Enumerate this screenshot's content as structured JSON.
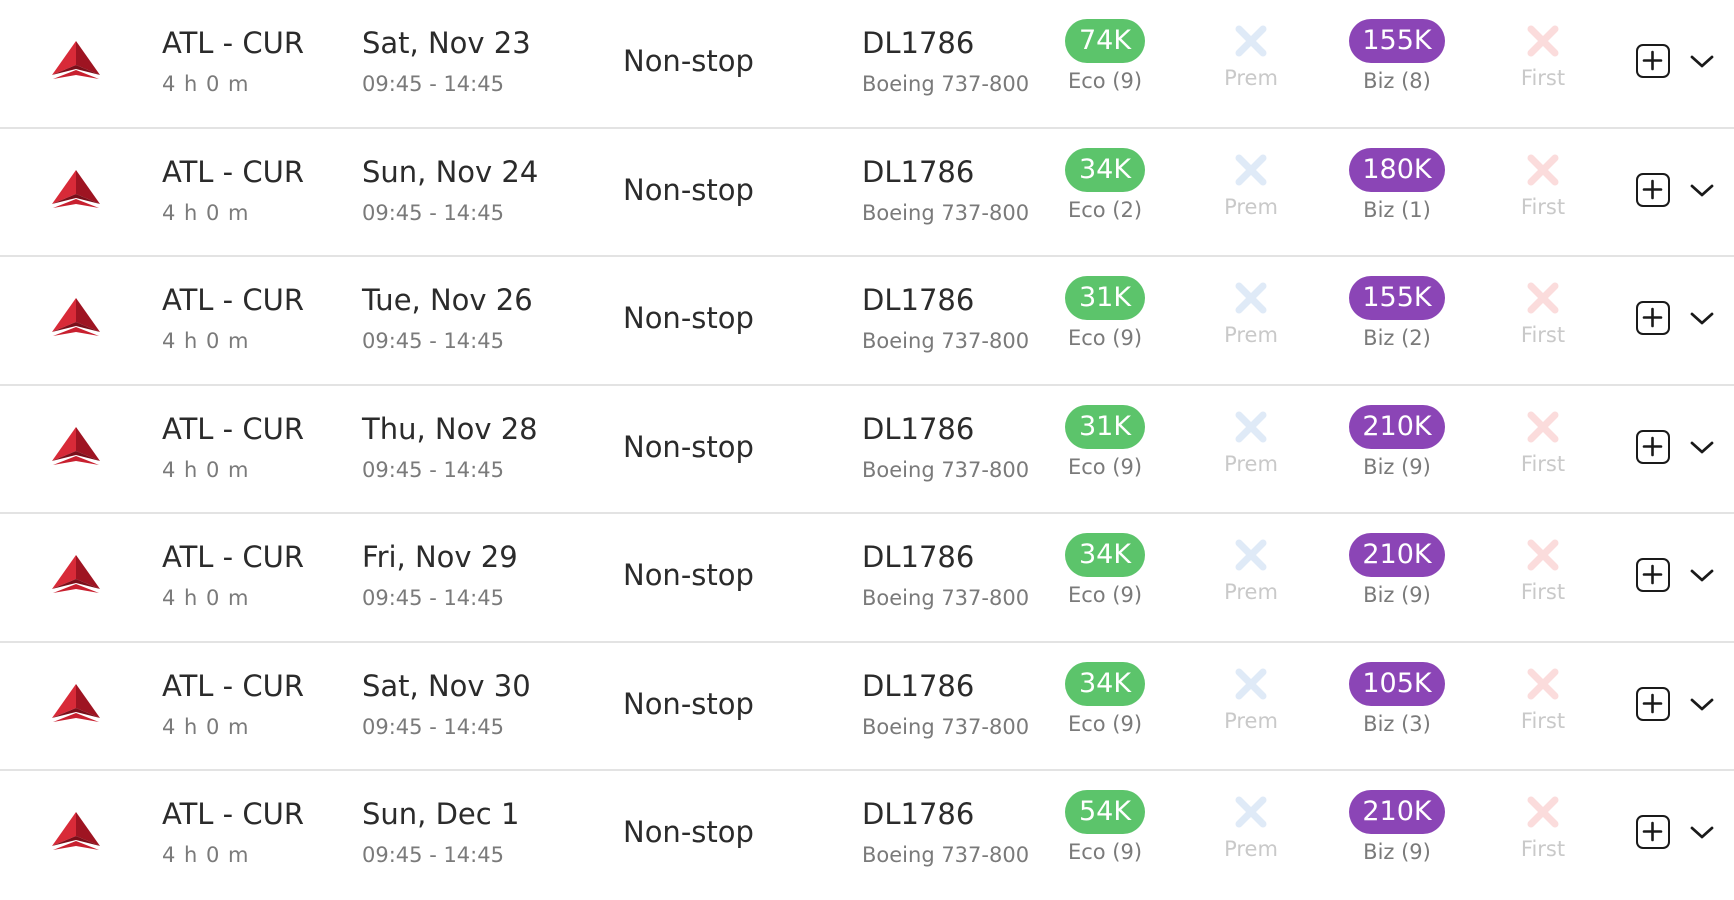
{
  "colors": {
    "eco_pill": "#5cc46b",
    "biz_pill": "#8b45b6",
    "prem_unavailable": "#dfeaf7",
    "first_unavailable": "#fbdcdc",
    "airline_logo": "#c8202f"
  },
  "icons": {
    "airline_logo": "delta-airline-logo-icon",
    "prem_unavailable": "x-mark-icon",
    "first_unavailable": "x-mark-icon",
    "add": "plus-square-icon",
    "expand": "chevron-down-icon"
  },
  "flights": [
    {
      "route": "ATL - CUR",
      "duration": "4 h 0 m",
      "date": "Sat, Nov 23",
      "times": "09:45 - 14:45",
      "stops": "Non-stop",
      "flight_no": "DL1786",
      "aircraft": "Boeing 737-800",
      "eco": {
        "price": "74K",
        "label": "Eco (9)"
      },
      "prem": {
        "label": "Prem"
      },
      "biz": {
        "price": "155K",
        "label": "Biz (8)"
      },
      "first": {
        "label": "First"
      }
    },
    {
      "route": "ATL - CUR",
      "duration": "4 h 0 m",
      "date": "Sun, Nov 24",
      "times": "09:45 - 14:45",
      "stops": "Non-stop",
      "flight_no": "DL1786",
      "aircraft": "Boeing 737-800",
      "eco": {
        "price": "34K",
        "label": "Eco (2)"
      },
      "prem": {
        "label": "Prem"
      },
      "biz": {
        "price": "180K",
        "label": "Biz (1)"
      },
      "first": {
        "label": "First"
      }
    },
    {
      "route": "ATL - CUR",
      "duration": "4 h 0 m",
      "date": "Tue, Nov 26",
      "times": "09:45 - 14:45",
      "stops": "Non-stop",
      "flight_no": "DL1786",
      "aircraft": "Boeing 737-800",
      "eco": {
        "price": "31K",
        "label": "Eco (9)"
      },
      "prem": {
        "label": "Prem"
      },
      "biz": {
        "price": "155K",
        "label": "Biz (2)"
      },
      "first": {
        "label": "First"
      }
    },
    {
      "route": "ATL - CUR",
      "duration": "4 h 0 m",
      "date": "Thu, Nov 28",
      "times": "09:45 - 14:45",
      "stops": "Non-stop",
      "flight_no": "DL1786",
      "aircraft": "Boeing 737-800",
      "eco": {
        "price": "31K",
        "label": "Eco (9)"
      },
      "prem": {
        "label": "Prem"
      },
      "biz": {
        "price": "210K",
        "label": "Biz (9)"
      },
      "first": {
        "label": "First"
      }
    },
    {
      "route": "ATL - CUR",
      "duration": "4 h 0 m",
      "date": "Fri, Nov 29",
      "times": "09:45 - 14:45",
      "stops": "Non-stop",
      "flight_no": "DL1786",
      "aircraft": "Boeing 737-800",
      "eco": {
        "price": "34K",
        "label": "Eco (9)"
      },
      "prem": {
        "label": "Prem"
      },
      "biz": {
        "price": "210K",
        "label": "Biz (9)"
      },
      "first": {
        "label": "First"
      }
    },
    {
      "route": "ATL - CUR",
      "duration": "4 h 0 m",
      "date": "Sat, Nov 30",
      "times": "09:45 - 14:45",
      "stops": "Non-stop",
      "flight_no": "DL1786",
      "aircraft": "Boeing 737-800",
      "eco": {
        "price": "34K",
        "label": "Eco (9)"
      },
      "prem": {
        "label": "Prem"
      },
      "biz": {
        "price": "105K",
        "label": "Biz (3)"
      },
      "first": {
        "label": "First"
      }
    },
    {
      "route": "ATL - CUR",
      "duration": "4 h 0 m",
      "date": "Sun, Dec 1",
      "times": "09:45 - 14:45",
      "stops": "Non-stop",
      "flight_no": "DL1786",
      "aircraft": "Boeing 737-800",
      "eco": {
        "price": "54K",
        "label": "Eco (9)"
      },
      "prem": {
        "label": "Prem"
      },
      "biz": {
        "price": "210K",
        "label": "Biz (9)"
      },
      "first": {
        "label": "First"
      }
    }
  ]
}
